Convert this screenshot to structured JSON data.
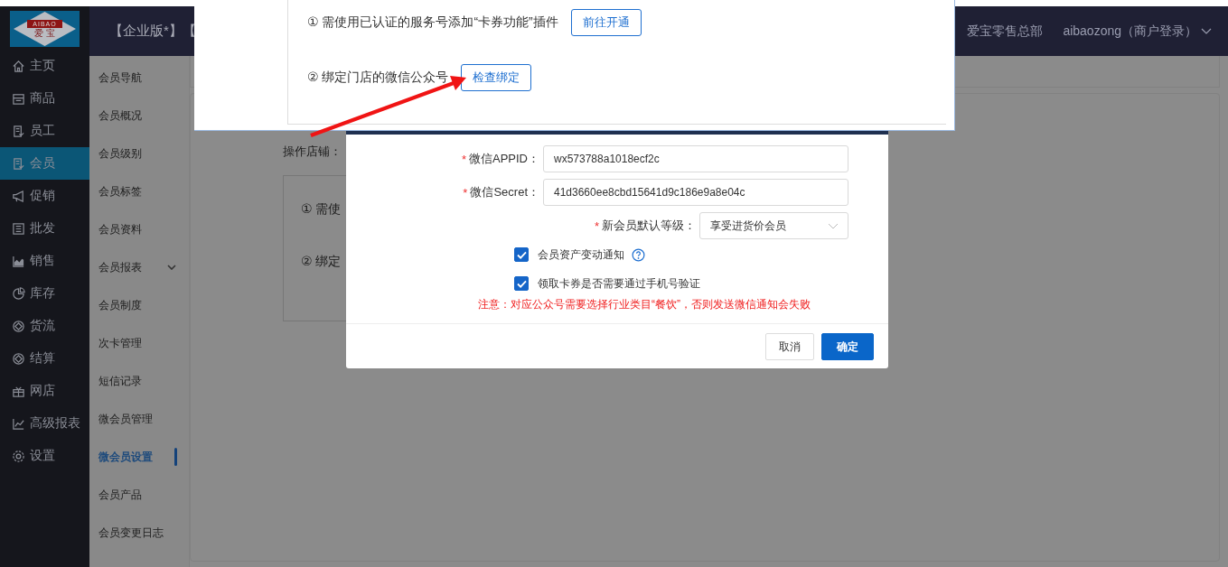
{
  "logo": {
    "title": "AIBAO",
    "subtitle": "爱 宝"
  },
  "top_header": {
    "edition": "【企业版*】【",
    "store": "爱宝零售总部",
    "account": "aibaozong（商户登录）"
  },
  "sidebar": {
    "items": [
      {
        "label": "主页",
        "selected": false
      },
      {
        "label": "商品",
        "selected": false
      },
      {
        "label": "员工",
        "selected": false
      },
      {
        "label": "会员",
        "selected": true
      },
      {
        "label": "促销",
        "selected": false
      },
      {
        "label": "批发",
        "selected": false
      },
      {
        "label": "销售",
        "selected": false
      },
      {
        "label": "库存",
        "selected": false
      },
      {
        "label": "货流",
        "selected": false
      },
      {
        "label": "结算",
        "selected": false
      },
      {
        "label": "网店",
        "selected": false
      },
      {
        "label": "高级报表",
        "selected": false
      },
      {
        "label": "设置",
        "selected": false
      }
    ]
  },
  "submenu": {
    "items": [
      {
        "label": "会员导航",
        "selected": false,
        "expandable": false
      },
      {
        "label": "会员概况",
        "selected": false,
        "expandable": false
      },
      {
        "label": "会员级别",
        "selected": false,
        "expandable": false
      },
      {
        "label": "会员标签",
        "selected": false,
        "expandable": false
      },
      {
        "label": "会员资料",
        "selected": false,
        "expandable": false
      },
      {
        "label": "会员报表",
        "selected": false,
        "expandable": true
      },
      {
        "label": "会员制度",
        "selected": false,
        "expandable": false
      },
      {
        "label": "次卡管理",
        "selected": false,
        "expandable": false
      },
      {
        "label": "短信记录",
        "selected": false,
        "expandable": false
      },
      {
        "label": "微会员管理",
        "selected": false,
        "expandable": false
      },
      {
        "label": "微会员设置",
        "selected": true,
        "expandable": false
      },
      {
        "label": "会员产品",
        "selected": false,
        "expandable": false
      },
      {
        "label": "会员变更日志",
        "selected": false,
        "expandable": false
      }
    ]
  },
  "content": {
    "store_label": "操作店铺：",
    "steps": [
      "① 需使",
      "② 绑定"
    ]
  },
  "dialog": {
    "fields": [
      {
        "kind": "input",
        "required_mark": "*",
        "label": "微信APPID：",
        "value": "wx573788a1018ecf2c"
      },
      {
        "kind": "input",
        "required_mark": "*",
        "label": "微信Secret：",
        "value": "41d3660ee8cbd15641d9c186e9a8e04c"
      },
      {
        "kind": "select",
        "required_mark": "*",
        "label": "新会员默认等级：",
        "value": "享受进货价会员"
      }
    ],
    "checkboxes": [
      {
        "label": "会员资产变动通知",
        "checked": true,
        "help": true
      },
      {
        "label": "领取卡券是否需要通过手机号验证",
        "checked": true,
        "help": false
      }
    ],
    "notice": "注意：对应公众号需要选择行业类目“餐饮”，否则发送微信通知会失败",
    "buttons": [
      {
        "label": "取消",
        "primary": false
      },
      {
        "label": "确定",
        "primary": true
      }
    ]
  },
  "overlay_panel": {
    "steps": [
      {
        "text": "① 需使用已认证的服务号添加“卡券功能”插件",
        "button": "前往开通"
      },
      {
        "text": "② 绑定门店的微信公众号",
        "button": "检查绑定"
      }
    ]
  }
}
